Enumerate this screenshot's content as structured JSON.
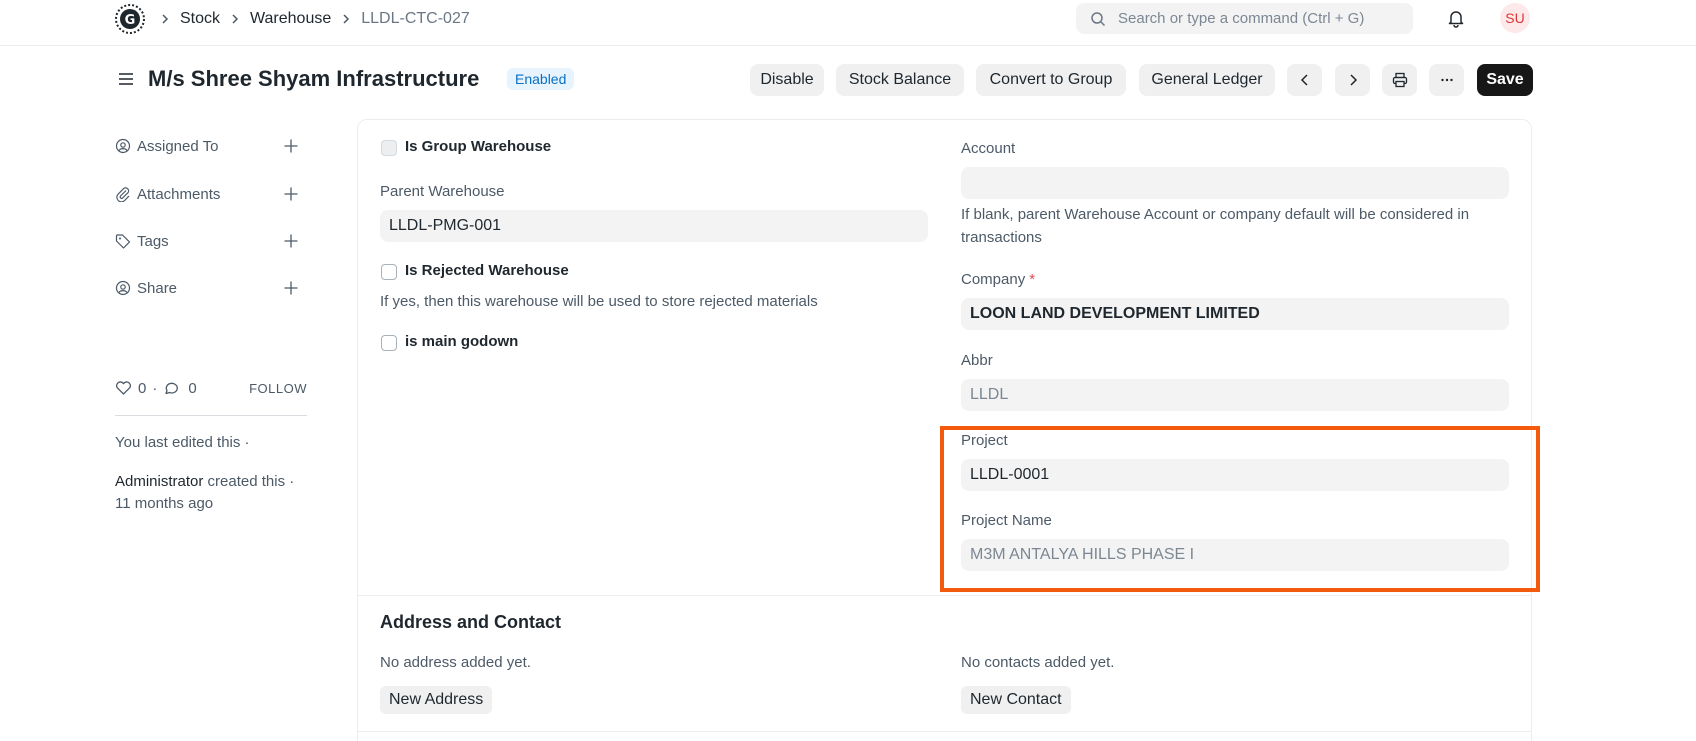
{
  "breadcrumb": [
    "Stock",
    "Warehouse",
    "LLDL-CTC-027"
  ],
  "search": {
    "placeholder": "Search or type a command (Ctrl + G)"
  },
  "user": {
    "initials": "SU"
  },
  "header": {
    "title": "M/s Shree Shyam Infrastructure",
    "status": "Enabled",
    "actions": [
      "Disable",
      "Stock Balance",
      "Convert to Group",
      "General Ledger"
    ],
    "save_label": "Save"
  },
  "sidebar": {
    "items": [
      "Assigned To",
      "Attachments",
      "Tags",
      "Share"
    ],
    "likes": "0",
    "comments": "0",
    "follow_label": "FOLLOW",
    "last_edited": "You last edited this ·",
    "created_by": "Administrator",
    "created_text": "created this ·",
    "created_ago": "11 months ago"
  },
  "form": {
    "is_group_warehouse_label": "Is Group Warehouse",
    "parent_warehouse_label": "Parent Warehouse",
    "parent_warehouse_value": "LLDL-PMG-001",
    "is_rejected_label": "Is Rejected Warehouse",
    "is_rejected_help": "If yes, then this warehouse will be used to store rejected materials",
    "main_godown_label": "is main godown",
    "account_label": "Account",
    "account_value": "",
    "account_help": "If blank, parent Warehouse Account or company default will be considered in transactions",
    "company_label": "Company",
    "company_value": "LOON LAND DEVELOPMENT LIMITED",
    "abbr_label": "Abbr",
    "abbr_value": "LLDL",
    "project_label": "Project",
    "project_value": "LLDL-0001",
    "project_name_label": "Project Name",
    "project_name_value": "M3M ANTALYA HILLS PHASE I"
  },
  "address_section": {
    "title": "Address and Contact",
    "no_address": "No address added yet.",
    "new_address": "New Address",
    "no_contacts": "No contacts added yet.",
    "new_contact": "New Contact"
  },
  "colors": {
    "accent": "#171717",
    "status_bg": "#e7f3fd",
    "status_text": "#0a70c5",
    "highlight": "#f35a0e",
    "required": "#e24c4c"
  }
}
